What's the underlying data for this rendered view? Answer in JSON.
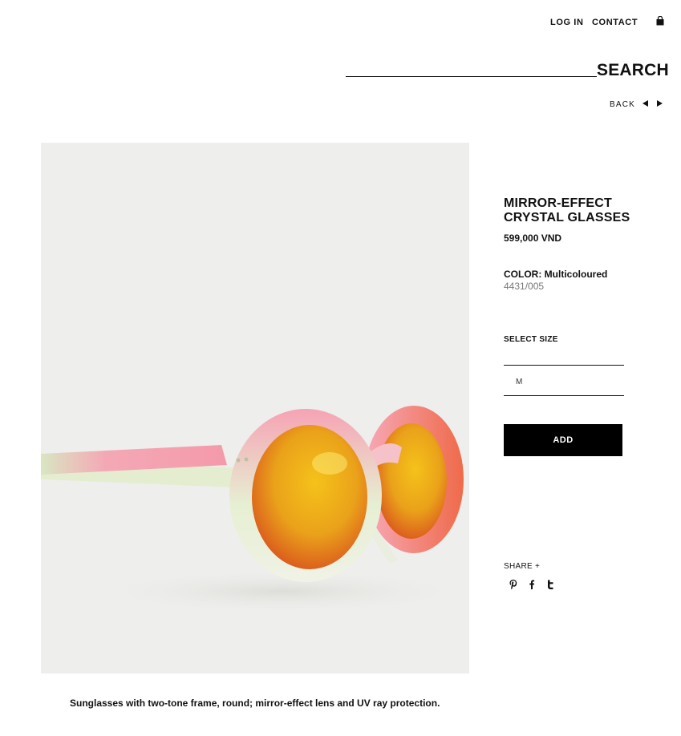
{
  "header": {
    "login_label": "LOG IN",
    "contact_label": "CONTACT",
    "search_label": "SEARCH",
    "search_placeholder": "",
    "back_label": "BACK"
  },
  "product": {
    "title": "MIRROR-EFFECT CRYSTAL GLASSES",
    "price": "599,000 VND",
    "color_prefix": "COLOR:",
    "color_value": "Multicoloured",
    "reference": "4431/005",
    "select_size_label": "SELECT SIZE",
    "size_options": [
      "M"
    ],
    "add_label": "ADD",
    "share_label": "SHARE +",
    "description": "Sunglasses with two-tone frame, round; mirror-effect lens and UV ray protection."
  },
  "icons": {
    "bag": "shopping-bag-icon",
    "prev": "arrow-left-icon",
    "next": "arrow-right-icon",
    "social": [
      "pinterest-icon",
      "facebook-icon",
      "tumblr-icon"
    ]
  },
  "colors": {
    "text": "#111111",
    "muted": "#777777",
    "button_bg": "#000000",
    "button_text": "#ffffff",
    "photo_bg": "#eeeeec"
  }
}
